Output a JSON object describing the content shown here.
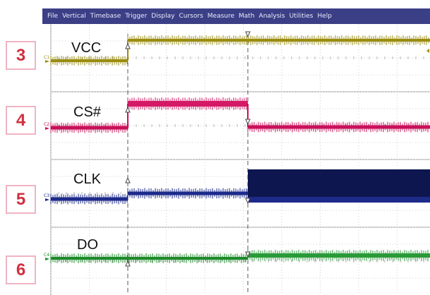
{
  "menu": [
    "File",
    "Vertical",
    "Timebase",
    "Trigger",
    "Display",
    "Cursors",
    "Measure",
    "Math",
    "Analysis",
    "Utilities",
    "Help"
  ],
  "channels": [
    {
      "badge": "3",
      "label": "VCC",
      "marker": "C1",
      "color": "#9a8c10",
      "fill": "#b5a81a"
    },
    {
      "badge": "4",
      "label": "CS#",
      "marker": "C2",
      "color": "#c8105a",
      "fill": "#d41a66"
    },
    {
      "badge": "5",
      "label": "CLK",
      "marker": "C3",
      "color": "#1c2a8a",
      "fill": "#0e1650"
    },
    {
      "badge": "6",
      "label": "DO",
      "marker": "C4",
      "color": "#1d8a2a",
      "fill": "#2a9a38"
    }
  ],
  "colors": {
    "menubar": "#3b3f85",
    "badge_border": "#f0b4c4",
    "badge_text": "#d03040",
    "grid": "#cfcfcf"
  }
}
